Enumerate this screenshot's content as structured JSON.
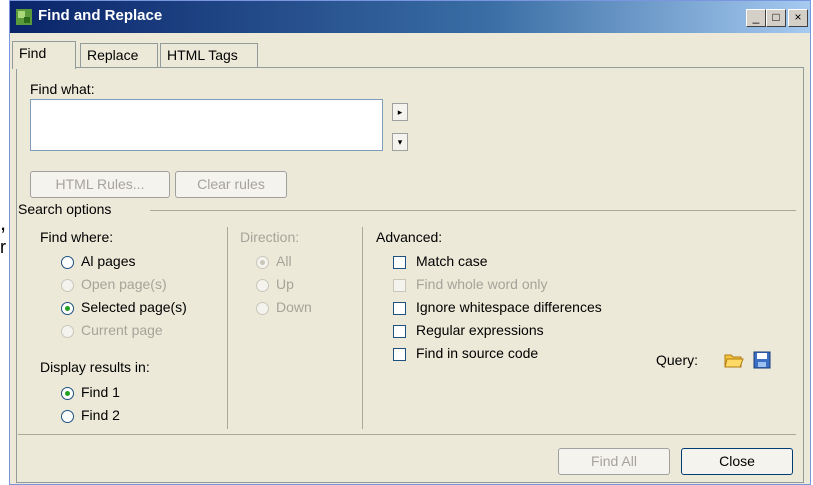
{
  "window": {
    "title": "Find and Replace"
  },
  "caption_buttons": {
    "minimize": "_",
    "maximize": "□",
    "close": "×"
  },
  "tabs": [
    {
      "label": "Find",
      "active": true
    },
    {
      "label": "Replace",
      "active": false
    },
    {
      "label": "HTML Tags",
      "active": false
    }
  ],
  "find_what": {
    "label": "Find what:",
    "value": ""
  },
  "buttons": {
    "html_rules": "HTML Rules...",
    "clear_rules": "Clear rules",
    "find_all": "Find All",
    "close": "Close"
  },
  "search_options": {
    "group_label": "Search options",
    "find_where": {
      "label": "Find where:",
      "options": [
        {
          "label": "Al pages",
          "selected": false,
          "enabled": true
        },
        {
          "label": "Open page(s)",
          "selected": false,
          "enabled": false
        },
        {
          "label": "Selected page(s)",
          "selected": true,
          "enabled": true
        },
        {
          "label": "Current page",
          "selected": false,
          "enabled": false
        }
      ]
    },
    "display_results": {
      "label": "Display results in:",
      "options": [
        {
          "label": "Find 1",
          "selected": true
        },
        {
          "label": "Find 2",
          "selected": false
        }
      ]
    },
    "direction": {
      "label": "Direction:",
      "options": [
        {
          "label": "All",
          "selected": true
        },
        {
          "label": "Up",
          "selected": false
        },
        {
          "label": "Down",
          "selected": false
        }
      ]
    },
    "advanced": {
      "label": "Advanced:",
      "options": [
        {
          "label": "Match case",
          "checked": false,
          "enabled": true
        },
        {
          "label": "Find whole word only",
          "checked": false,
          "enabled": false
        },
        {
          "label": "Ignore whitespace differences",
          "checked": false,
          "enabled": true
        },
        {
          "label": "Regular expressions",
          "checked": false,
          "enabled": true
        },
        {
          "label": "Find in source code",
          "checked": false,
          "enabled": true
        }
      ]
    },
    "query_label": "Query:"
  },
  "icons": {
    "app": "find-replace-app-icon",
    "open_query": "open-folder-icon",
    "save_query": "save-disk-icon"
  },
  "colors": {
    "title_gradient_start": "#0a246a",
    "title_gradient_end": "#a6caf0",
    "dialog_bg": "#ece9d8"
  },
  "left_edge": {
    "glyph1": ",",
    "glyph2": "r"
  }
}
